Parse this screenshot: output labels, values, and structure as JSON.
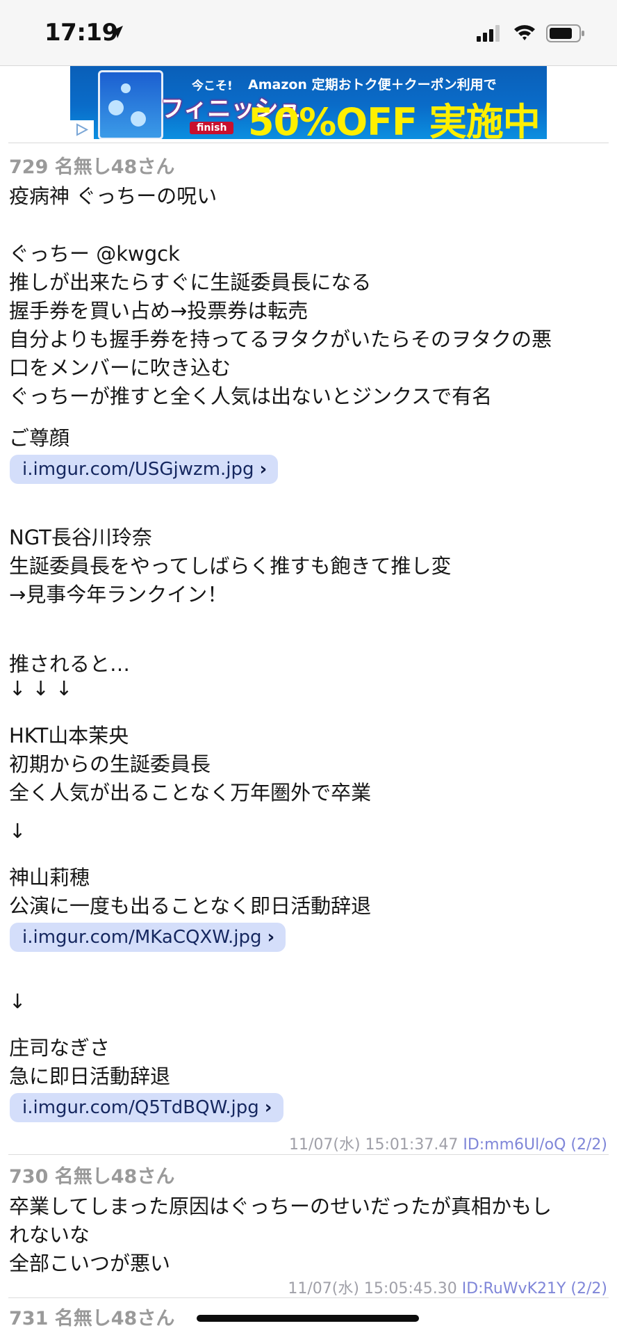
{
  "status_bar": {
    "time": "17:19",
    "icons": [
      "location-arrow-icon",
      "cellular-signal-icon",
      "wifi-icon",
      "battery-icon"
    ]
  },
  "ad": {
    "now_text": "今こそ!",
    "brand": "フィニッシュ",
    "brand_sub": "finish",
    "headline_top": "Amazon 定期おトク便＋クーポン利用で",
    "headline_big": "50%OFF 実施中",
    "colors": {
      "background": "#0a6cc9",
      "headline": "#ffef00"
    }
  },
  "posts": [
    {
      "header": "729 名無し48さん",
      "lines": {
        "l1": "疫病神 ぐっちーの呪い",
        "l2": "ぐっちー @kwgck",
        "l3": "推しが出来たらすぐに生誕委員長になる",
        "l4": "握手券を買い占め→投票券は転売",
        "l5": "自分よりも握手券を持ってるヲタクがいたらそのヲタクの悪",
        "l6": "口をメンバーに吹き込む",
        "l7": "ぐっちーが推すと全く人気は出ないとジンクスで有名",
        "l8": "ご尊顔",
        "l9": "NGT長谷川玲奈",
        "l10": "生誕委員長をやってしばらく推すも飽きて推し変",
        "l11": "→見事今年ランクイン！",
        "l12": "推されると…",
        "l13": "↓ ↓ ↓",
        "l14": "HKT山本茉央",
        "l15": "初期からの生誕委員長",
        "l16": "全く人気が出ることなく万年圏外で卒業",
        "l17": "↓",
        "l18": "神山莉穂",
        "l19": "公演に一度も出ることなく即日活動辞退",
        "l20": "↓",
        "l21": "庄司なぎさ",
        "l22": "急に即日活動辞退"
      },
      "links": [
        "i.imgur.com/USGjwzm.jpg",
        "i.imgur.com/MKaCQXW.jpg",
        "i.imgur.com/Q5TdBQW.jpg"
      ],
      "meta_date": "11/07(水) 15:01:37.47",
      "meta_id": "ID:mm6Ul/oQ (2/2)"
    },
    {
      "header": "730 名無し48さん",
      "lines": {
        "l1": "卒業してしまった原因はぐっちーのせいだったが真相かもし",
        "l2": "れないな",
        "l3": "全部こいつが悪い"
      },
      "meta_date": "11/07(水) 15:05:45.30",
      "meta_id": "ID:RuWvK21Y (2/2)"
    },
    {
      "header": "731 名無し48さん"
    }
  ],
  "colors": {
    "link_pill_bg": "#d4defa",
    "id_color": "#7f86d8",
    "header_gray": "#9a9a9a"
  }
}
